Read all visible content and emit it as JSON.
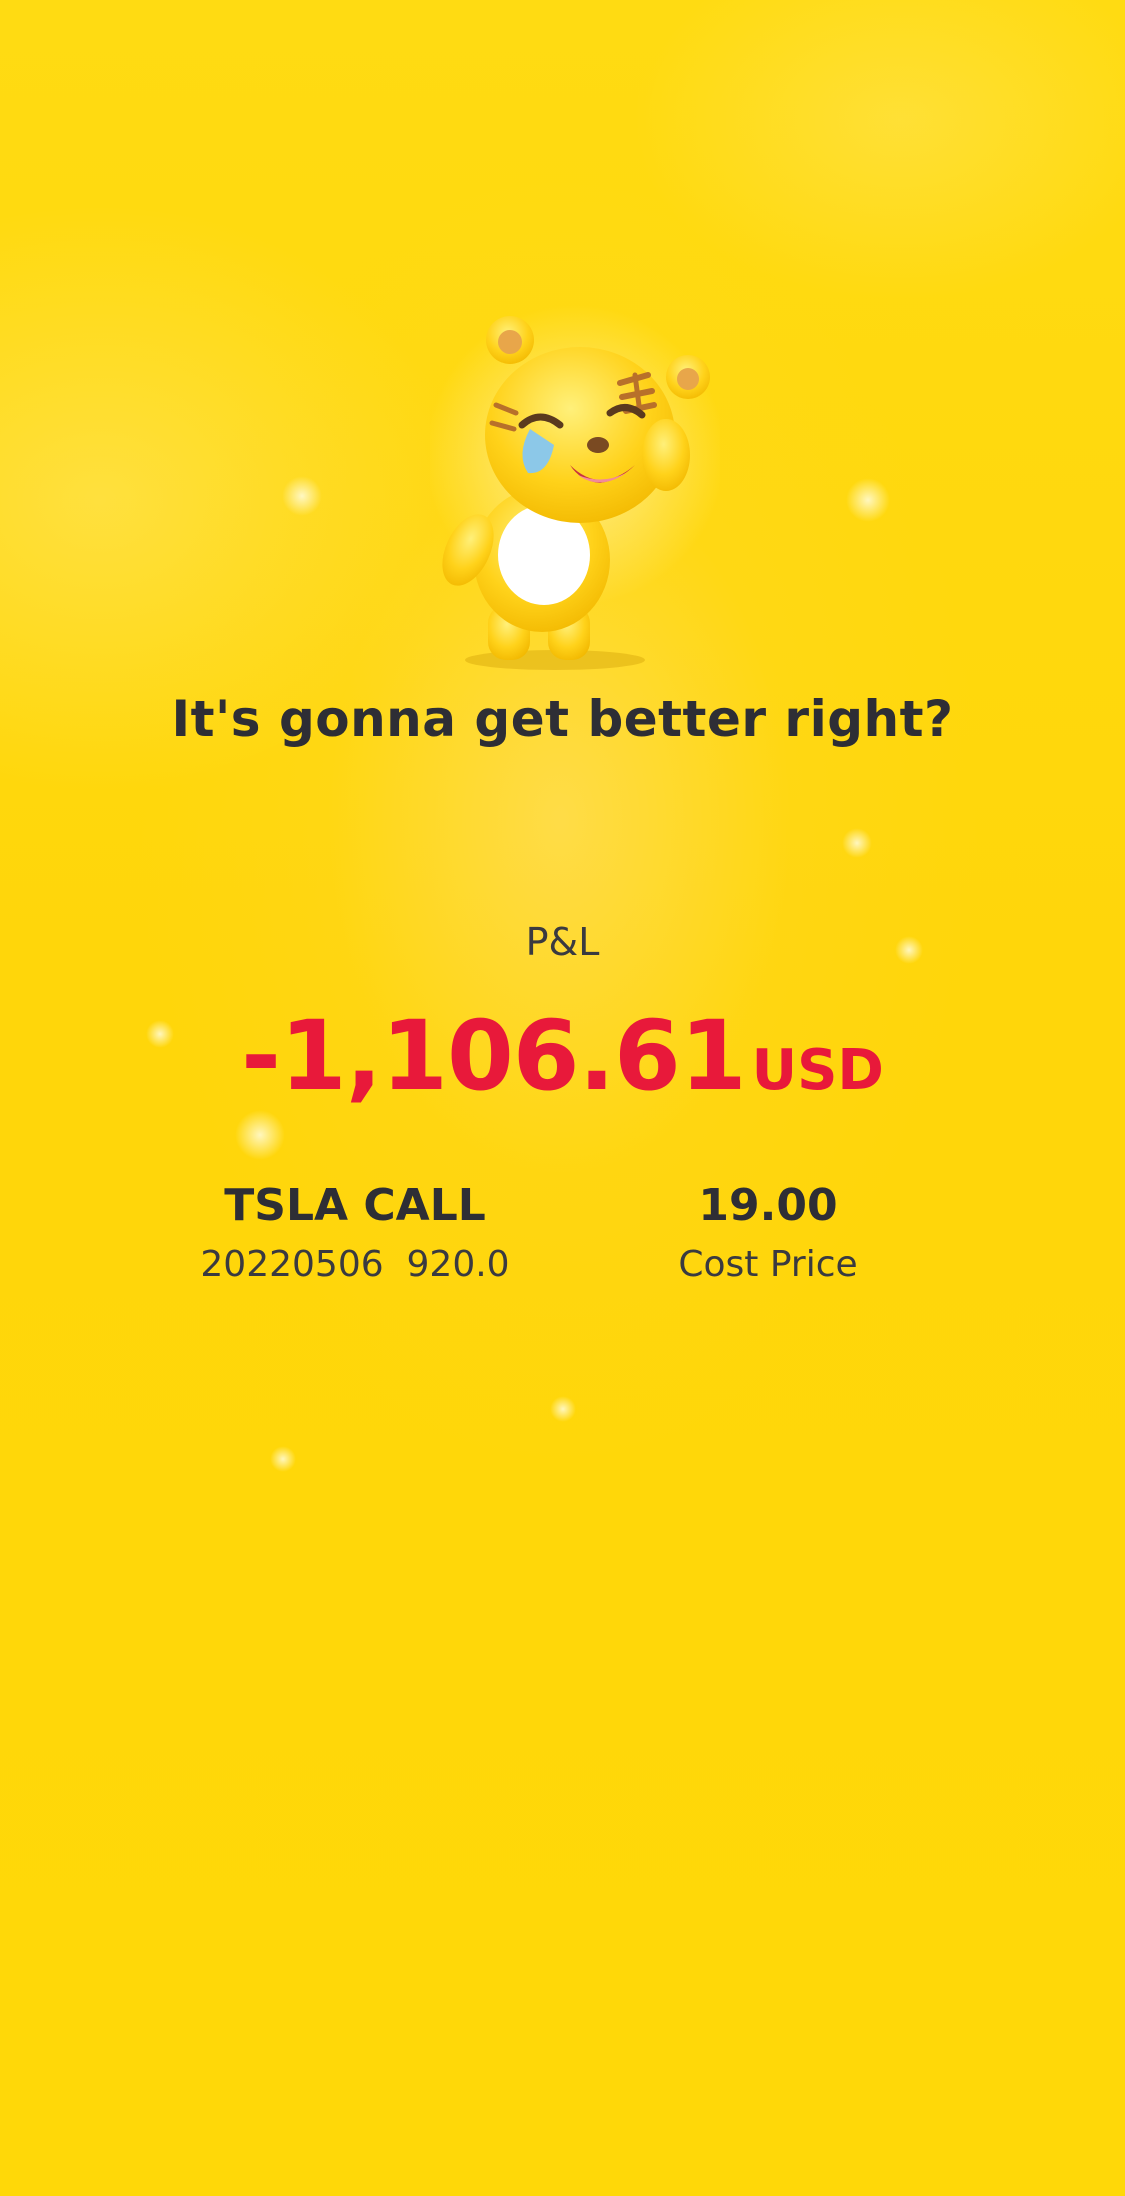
{
  "headline": "It's gonna get better right?",
  "pnl": {
    "label": "P&L",
    "amount": "-1,106.61",
    "currency": "USD"
  },
  "position": {
    "name": "TSLA CALL",
    "details": "20220506  920.0"
  },
  "cost": {
    "value": "19.00",
    "label": "Cost Price"
  },
  "mascot_icon": "crying-tiger-mascot-icon",
  "colors": {
    "background": "#FFD90A",
    "loss_red": "#E8193A",
    "text_dark": "#2E2E35"
  }
}
